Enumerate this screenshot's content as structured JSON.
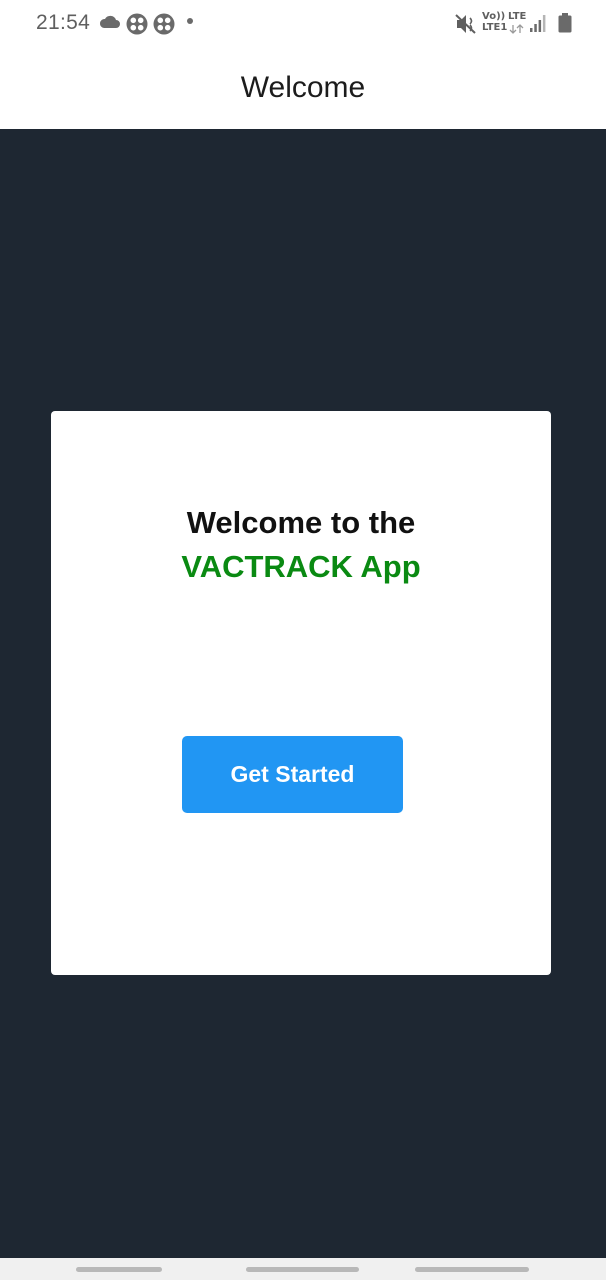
{
  "status_bar": {
    "time": "21:54",
    "volte_top": "Vo))",
    "volte_bottom": "LTE1",
    "lte": "LTE",
    "icons": [
      "cloud-icon",
      "app-notification-icon",
      "app-notification-icon",
      "dot-icon",
      "mute-icon",
      "volte-icon",
      "lte-icon",
      "signal-icon",
      "battery-icon"
    ]
  },
  "header": {
    "title": "Welcome"
  },
  "card": {
    "line1": "Welcome to the",
    "line2": "VACTRACK App",
    "button_label": "Get Started"
  },
  "colors": {
    "background": "#1e2732",
    "accent_green": "#0a8a12",
    "button_blue": "#2196f3"
  }
}
